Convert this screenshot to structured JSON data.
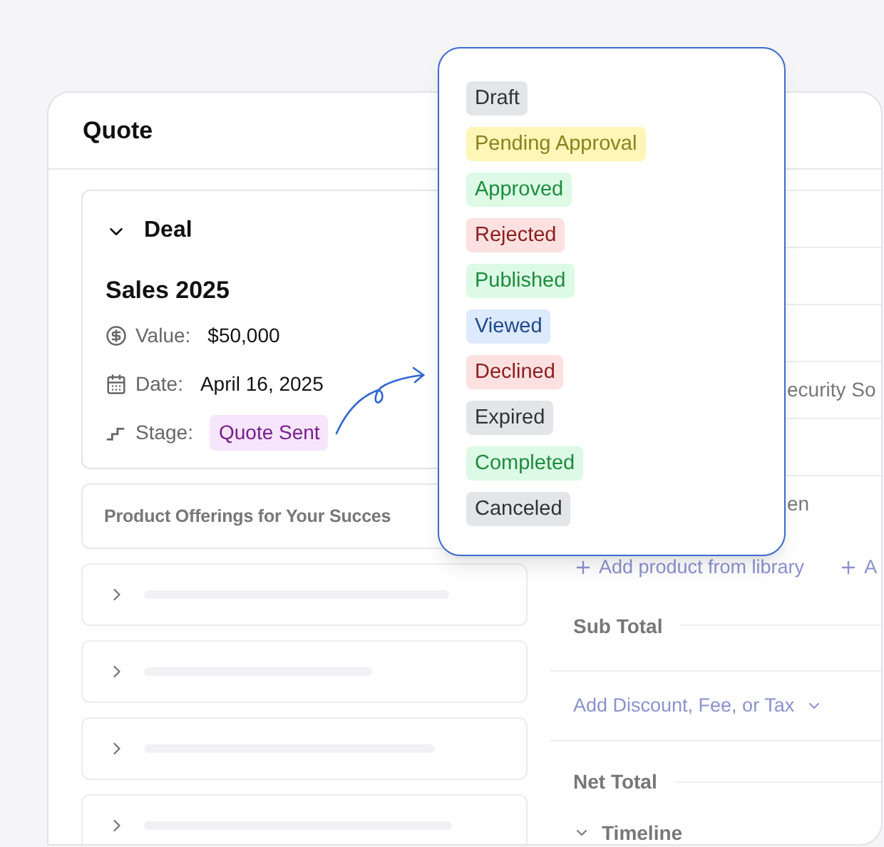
{
  "card": {
    "title": "Quote"
  },
  "deal": {
    "heading": "Deal",
    "expanded": true,
    "name": "Sales 2025",
    "fields": [
      {
        "kind": "value",
        "label": "Value:",
        "value": "$50,000"
      },
      {
        "kind": "date",
        "label": "Date:",
        "value": "April 16, 2025"
      },
      {
        "kind": "stage",
        "label": "Stage:",
        "value": "Quote Sent",
        "color": "#f7e6fb"
      }
    ]
  },
  "offerings": {
    "title": "Product Offerings for Your Succes"
  },
  "product_rows": [
    {
      "expanded": false
    },
    {
      "expanded": false
    },
    {
      "expanded": false
    },
    {
      "expanded": false
    }
  ],
  "right_rows": [
    "",
    "",
    "",
    "ecurity So",
    "",
    "en"
  ],
  "links": [
    "Add product from library",
    "A"
  ],
  "sub_total": "Sub Total",
  "discount": "Add Discount, Fee, or Tax",
  "net_total": "Net Total",
  "timeline": "Timeline",
  "stages": [
    {
      "label": "Draft",
      "color": "#e4e5e8"
    },
    {
      "label": "Pending Approval",
      "color": "#fdf6b6"
    },
    {
      "label": "Approved",
      "color": "#dcfae5"
    },
    {
      "label": "Rejected",
      "color": "#fde1e1"
    },
    {
      "label": "Published",
      "color": "#dcfae5"
    },
    {
      "label": "Viewed",
      "color": "#dde9fc"
    },
    {
      "label": "Declined",
      "color": "#fde1e1"
    },
    {
      "label": "Expired",
      "color": "#e4e5e8"
    },
    {
      "label": "Completed",
      "color": "#dcfae5"
    },
    {
      "label": "Canceled",
      "color": "#e4e5e8"
    }
  ]
}
